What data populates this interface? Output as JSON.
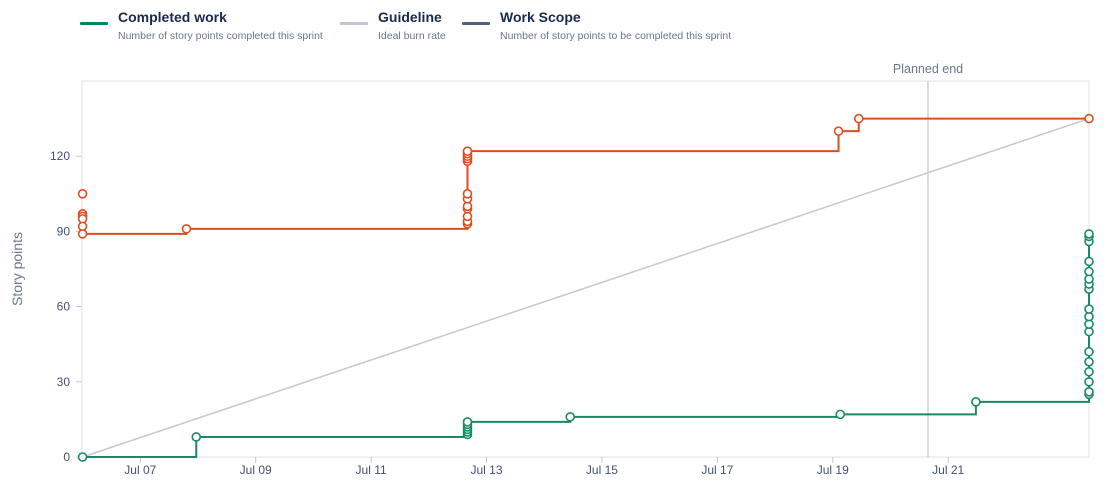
{
  "legend": [
    {
      "label": "Completed work",
      "description": "Number of story points completed this sprint",
      "color": "#00875a"
    },
    {
      "label": "Guideline",
      "description": "Ideal burn rate",
      "color": "#c1c7d0"
    },
    {
      "label": "Work Scope",
      "description": "Number of story points to be completed this sprint",
      "color": "#505f79"
    }
  ],
  "chart_data": {
    "type": "line",
    "ylabel": "Story points",
    "xlabel": "",
    "y_ticks": [
      0,
      30,
      60,
      90,
      120
    ],
    "x_ticks": [
      {
        "day": 7,
        "label": "Jul 07"
      },
      {
        "day": 9,
        "label": "Jul 09"
      },
      {
        "day": 11,
        "label": "Jul 11"
      },
      {
        "day": 13,
        "label": "Jul 13"
      },
      {
        "day": 15,
        "label": "Jul 15"
      },
      {
        "day": 17,
        "label": "Jul 17"
      },
      {
        "day": 19,
        "label": "Jul 19"
      },
      {
        "day": 21,
        "label": "Jul 21"
      }
    ],
    "xlim": [
      5.99,
      23.44
    ],
    "ylim": [
      0,
      150
    ],
    "grid": false,
    "annotations": [
      {
        "day": 20.65,
        "label": "Planned end"
      }
    ],
    "series": [
      {
        "name": "Work Scope",
        "color": "#de4d1f",
        "step_points": [
          [
            6.0,
            89
          ],
          [
            7.8,
            91
          ],
          [
            12.67,
            122
          ],
          [
            19.1,
            130
          ],
          [
            19.45,
            135
          ],
          [
            23.44,
            135
          ]
        ],
        "markers": [
          [
            6.0,
            105
          ],
          [
            6.0,
            97
          ],
          [
            6.0,
            96
          ],
          [
            6.0,
            95
          ],
          [
            6.0,
            92
          ],
          [
            6.0,
            89
          ],
          [
            7.8,
            91
          ],
          [
            12.67,
            93
          ],
          [
            12.67,
            94
          ],
          [
            12.67,
            96
          ],
          [
            12.67,
            99
          ],
          [
            12.67,
            100
          ],
          [
            12.67,
            103
          ],
          [
            12.67,
            105
          ],
          [
            12.67,
            118
          ],
          [
            12.67,
            119
          ],
          [
            12.67,
            120
          ],
          [
            12.67,
            121
          ],
          [
            12.67,
            122
          ],
          [
            19.1,
            130
          ],
          [
            19.45,
            135
          ],
          [
            23.44,
            135
          ]
        ]
      },
      {
        "name": "Guideline",
        "color": "#c8c8c8",
        "line_points": [
          [
            6.0,
            0
          ],
          [
            23.44,
            135
          ]
        ]
      },
      {
        "name": "Completed work",
        "color": "#1a8a66",
        "step_points": [
          [
            6.0,
            0
          ],
          [
            7.97,
            8
          ],
          [
            12.67,
            14
          ],
          [
            14.45,
            16
          ],
          [
            19.13,
            17
          ],
          [
            21.48,
            22
          ],
          [
            23.44,
            89
          ]
        ],
        "markers": [
          [
            6.0,
            0
          ],
          [
            7.97,
            8
          ],
          [
            12.67,
            9
          ],
          [
            12.67,
            10
          ],
          [
            12.67,
            11
          ],
          [
            12.67,
            12
          ],
          [
            12.67,
            13
          ],
          [
            12.67,
            14
          ],
          [
            14.45,
            16
          ],
          [
            19.13,
            17
          ],
          [
            21.48,
            22
          ],
          [
            23.44,
            25
          ],
          [
            23.44,
            26
          ],
          [
            23.44,
            30
          ],
          [
            23.44,
            34
          ],
          [
            23.44,
            38
          ],
          [
            23.44,
            42
          ],
          [
            23.44,
            50
          ],
          [
            23.44,
            53
          ],
          [
            23.44,
            56
          ],
          [
            23.44,
            59
          ],
          [
            23.44,
            67
          ],
          [
            23.44,
            69
          ],
          [
            23.44,
            71
          ],
          [
            23.44,
            74
          ],
          [
            23.44,
            78
          ],
          [
            23.44,
            86
          ],
          [
            23.44,
            88
          ],
          [
            23.44,
            89
          ]
        ]
      }
    ]
  }
}
